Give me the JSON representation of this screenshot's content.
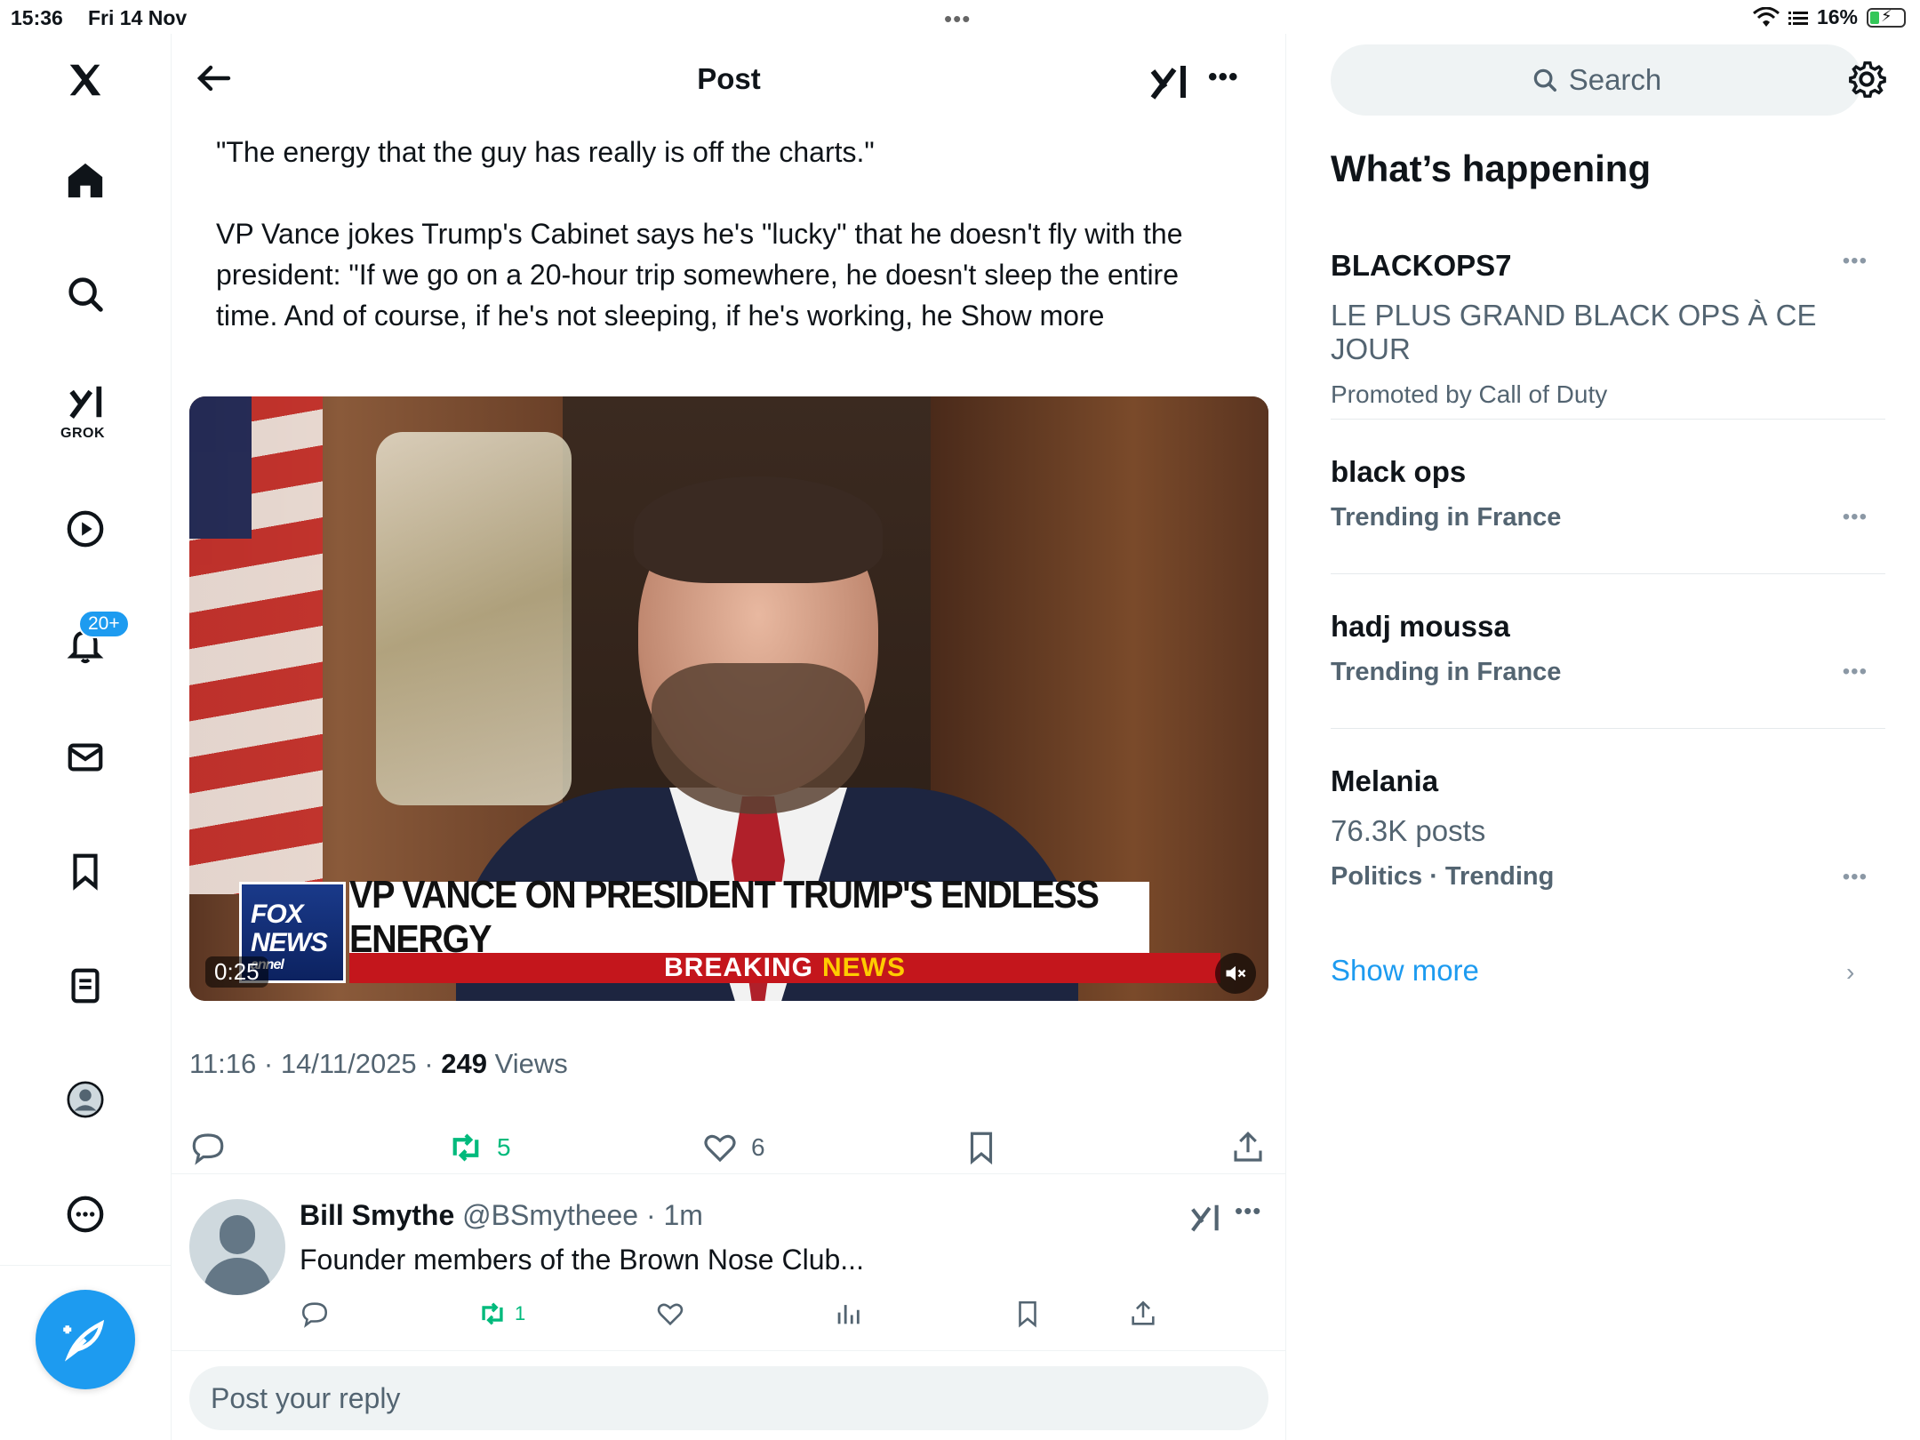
{
  "status_bar": {
    "time": "15:36",
    "date": "Fri 14 Nov",
    "battery": "16%"
  },
  "nav": {
    "grok_label": "GROK",
    "notifications_badge": "20+"
  },
  "header": {
    "title": "Post"
  },
  "post": {
    "text_1": "\"The energy that the guy has really is off the charts.\"",
    "text_2": "VP Vance jokes Trump's Cabinet says he's \"lucky\" that he doesn't fly with the president: \"If we go on a 20-hour trip somewhere, he doesn't sleep the entire time. And of course, if he's not sleeping, if he's working, he Show more",
    "video": {
      "logo_line1": "FOX",
      "logo_line2": "NEWS",
      "logo_line3": "annel",
      "headline": "VP VANCE ON PRESIDENT TRUMP'S ENDLESS ENERGY",
      "breaking_1": "BREAKING",
      "breaking_2": "NEWS",
      "duration": "0:25"
    },
    "timestamp": "11:16 · 14/11/2025 · ",
    "views_count": "249",
    "views_label": " Views",
    "retweets": "5",
    "likes": "6"
  },
  "reply": {
    "name": "Bill Smythe",
    "handle": " @BSmytheee · 1m",
    "text": "Founder members of the Brown Nose Club...",
    "retweets": "1"
  },
  "reply_box": {
    "placeholder": "Post your reply"
  },
  "sidebar": {
    "search_placeholder": "Search",
    "section_title": "What’s happening",
    "trends": [
      {
        "title": "BLACKOPS7",
        "subtitle": "LE PLUS GRAND BLACK OPS À CE JOUR",
        "meta": "Promoted by Call of Duty"
      },
      {
        "title": "black ops",
        "context": "Trending in France"
      },
      {
        "title": "hadj moussa",
        "context": "Trending in France"
      },
      {
        "title": "Melania",
        "count": "76.3K posts",
        "context": "Politics · Trending"
      }
    ],
    "show_more": "Show more"
  },
  "colors": {
    "accent": "#1d9bf0",
    "retweet_green": "#00ba7c",
    "secondary_text": "#536471"
  }
}
